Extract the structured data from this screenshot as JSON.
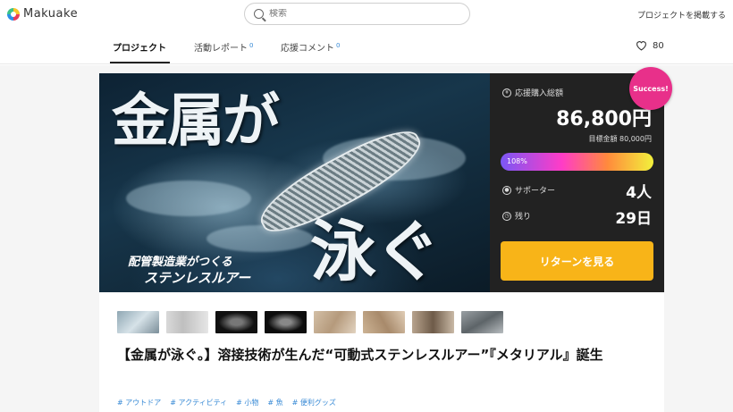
{
  "header": {
    "logo_text": "Makuake",
    "search_placeholder": "検索",
    "post_project_label": "プロジェクトを掲載する"
  },
  "nav": {
    "tabs": [
      {
        "label": "プロジェクト",
        "count": ""
      },
      {
        "label": "活動レポート",
        "count": "0"
      },
      {
        "label": "応援コメント",
        "count": "0"
      }
    ],
    "likes_count": "80"
  },
  "hero": {
    "title_line1": "金属が",
    "title_line2": "泳ぐ",
    "subtitle_line1": "配管製造業がつくる",
    "subtitle_line2": "ステンレスルアー"
  },
  "panel": {
    "success_badge": "Success!",
    "amount_label": "応援購入総額",
    "amount": "86,800円",
    "target": "目標金額 80,000円",
    "progress_text": "108%",
    "progress": 1.08,
    "supporters_label": "サポーター",
    "supporters_value": "4人",
    "remaining_label": "残り",
    "remaining_value": "29日",
    "return_button": "リターンを見る"
  },
  "content": {
    "headline": "【金属が泳ぐ。】溶接技術が生んだ“可動式ステンレスルアー”『メタリアル』誕生",
    "tags": [
      "# アウトドア",
      "# アクティビティ",
      "# 小物",
      "# 魚",
      "# 便利グッズ"
    ]
  },
  "colors": {
    "accent_yellow": "#f8b418",
    "success_pink": "#e8308a",
    "tag_blue": "#3a8bd6",
    "panel_bg": "#222222"
  }
}
